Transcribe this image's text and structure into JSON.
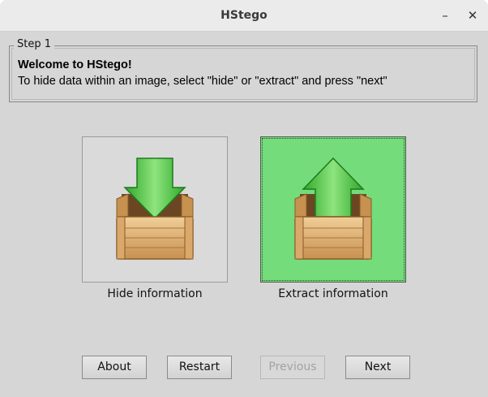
{
  "window": {
    "title": "HStego",
    "minimize_glyph": "–",
    "close_glyph": "✕"
  },
  "step": {
    "legend": "Step 1",
    "heading": "Welcome to HStego!",
    "instructions": "To hide data within an image, select \"hide\" or \"extract\" and press \"next\""
  },
  "options": [
    {
      "label": "Hide information",
      "icon": "box-down-arrow-icon",
      "selected": false
    },
    {
      "label": "Extract information",
      "icon": "box-up-arrow-icon",
      "selected": true
    }
  ],
  "buttons": {
    "about": "About",
    "restart": "Restart",
    "previous": "Previous",
    "next": "Next"
  },
  "colors": {
    "selected_bg": "#74dc7a",
    "arrow_green": "#3fbf3a",
    "crate_wood": "#d9a86a"
  }
}
